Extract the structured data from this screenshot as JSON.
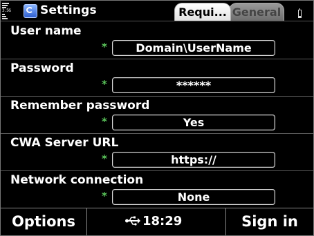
{
  "status": {
    "network_mode": "3.5G",
    "title": "Settings",
    "tabs": [
      {
        "label": "Requi...",
        "active": true
      },
      {
        "label": "General",
        "active": false
      }
    ]
  },
  "form": {
    "required_marker": "*",
    "fields": [
      {
        "label": "User name",
        "value": "Domain\\UserName",
        "required": true
      },
      {
        "label": "Password",
        "value": "******",
        "required": true
      },
      {
        "label": "Remember password",
        "value": "Yes",
        "required": true
      },
      {
        "label": "CWA Server URL",
        "value": "https://",
        "required": true
      },
      {
        "label": "Network connection",
        "value": "None",
        "required": true
      }
    ]
  },
  "softkeys": {
    "left": "Options",
    "right": "Sign in",
    "time": "18:29",
    "connection_icon": "usb-icon"
  },
  "colors": {
    "background": "#000000",
    "required_marker": "#5cc85c",
    "active_tab": "#ffffff",
    "inactive_tab": "#7f7f7f"
  }
}
